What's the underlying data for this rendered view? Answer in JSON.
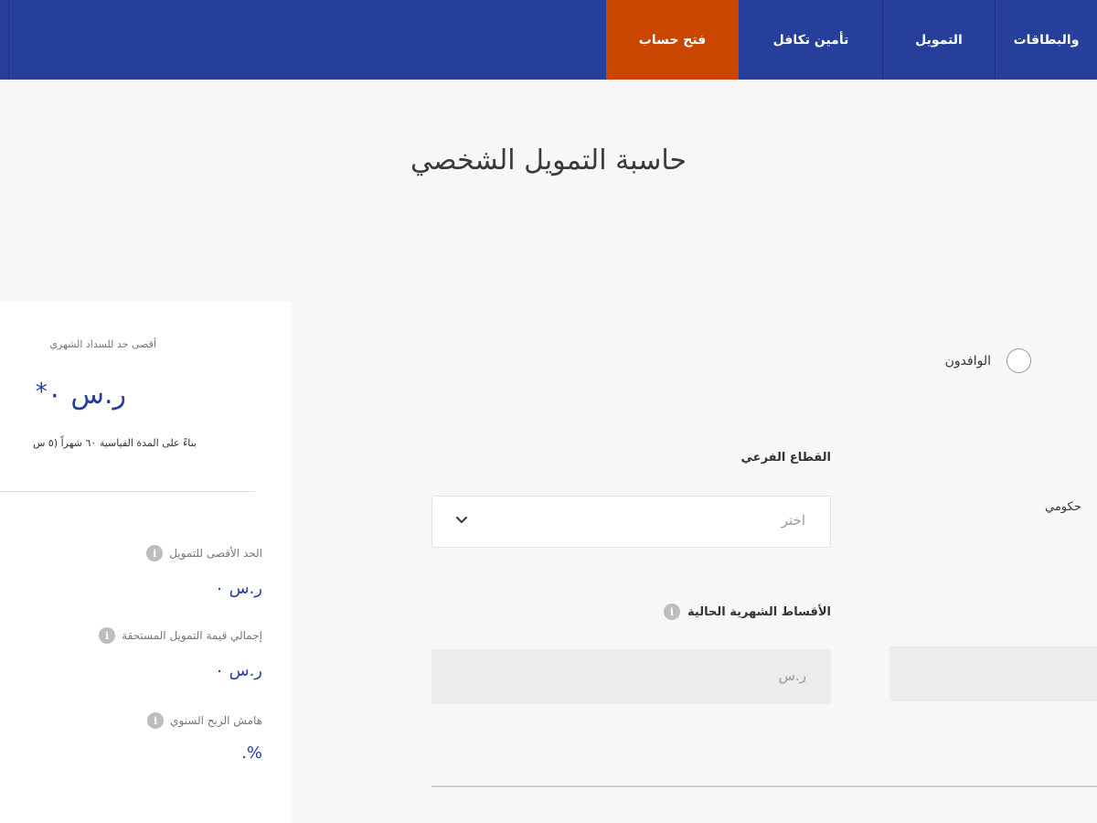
{
  "nav": {
    "items": [
      {
        "label": "والبطاقات"
      },
      {
        "label": "التمويل"
      },
      {
        "label": "تأمين تكافل"
      },
      {
        "label": "فتح حساب"
      }
    ]
  },
  "page": {
    "title": "حاسبة التمويل الشخصي"
  },
  "results": {
    "max_monthly_label": "أقصى حد للسداد الشهري",
    "max_monthly_value": "ر.س ٠",
    "asterisk": "*",
    "basis_note": "بناءً على المدة القياسية ٦٠ شهراً (٥ س",
    "max_financing_label": "الحد الأقصى للتمويل",
    "max_financing_value": "ر.س ٠",
    "total_due_label": "إجمالي قيمة التمويل المستحقة",
    "total_due_value": "ر.س ٠",
    "annual_margin_label": "هامش الربح السنوي",
    "annual_margin_value": "%."
  },
  "form": {
    "radio_expats_label": "الوافدون",
    "subsector_label": "القطاع الفرعي",
    "subsector_placeholder": "اختر",
    "government_label": "حكومي",
    "current_installments_label": "الأقساط الشهرية الحالية",
    "current_installments_placeholder": "ر.س"
  },
  "colors": {
    "nav_bg": "#263f9b",
    "accent_orange": "#c94600",
    "value_blue": "#263f9b"
  }
}
